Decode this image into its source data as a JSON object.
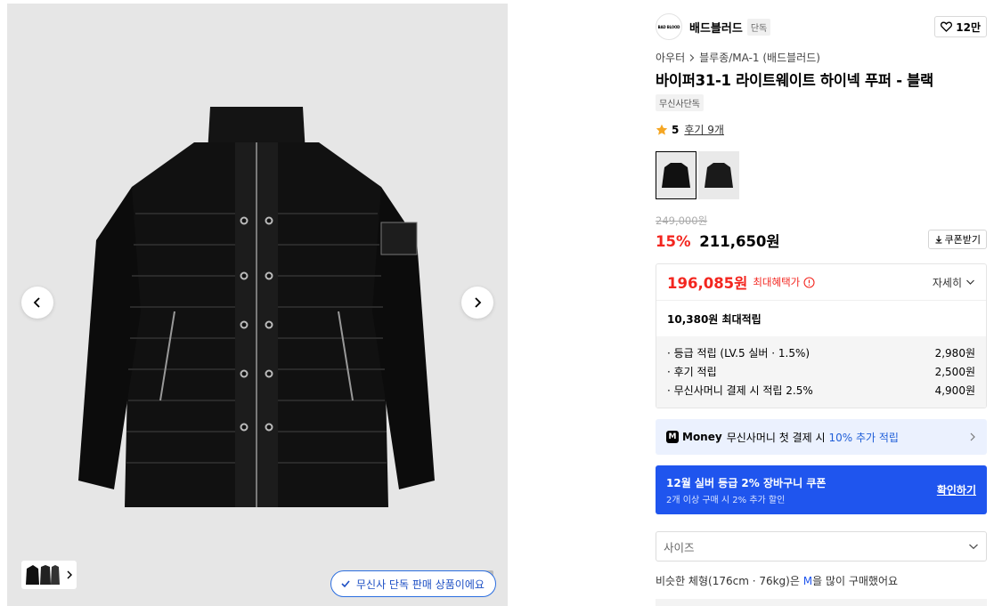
{
  "gallery": {
    "product_image": "black-lightweight-puffer-jacket",
    "prev_icon": "chevron-left-icon",
    "next_icon": "chevron-right-icon",
    "exclusive_notice": "무신사 단독 판매 상품이에요"
  },
  "brand": {
    "logo_text": "BAD BLOOD",
    "name": "배드블러드",
    "badge": "단독",
    "likes": "12만"
  },
  "breadcrumb": {
    "category": "아우터",
    "subcategory": "블루종/MA-1 (배드블러드)"
  },
  "product": {
    "title": "바이퍼31-1 라이트웨이트 하이넥 푸퍼 - 블랙",
    "tag": "무신사단독",
    "rating": "5",
    "reviews": "후기 9개"
  },
  "price": {
    "original": "249,000원",
    "discount": "15%",
    "sale": "211,650원",
    "coupon_button": "쿠폰받기"
  },
  "benefit": {
    "max_price": "196,085원",
    "max_label": "최대혜택가",
    "detail_button": "자세히",
    "points_total": "10,380원 최대적립",
    "lines": [
      {
        "label": "· 등급 적립 (LV.5 실버 · 1.5%)",
        "value": "2,980원"
      },
      {
        "label": "· 후기 적립",
        "value": "2,500원"
      },
      {
        "label": "· 무신사머니 결제 시 적립 2.5%",
        "value": "4,900원"
      }
    ]
  },
  "money_banner": {
    "logo": "M",
    "word": "Money",
    "text": "무신사머니 첫 결제 시",
    "highlight": "10% 추가 적립"
  },
  "coupon_banner": {
    "title": "12월 실버 등급 2% 장바구니 쿠폰",
    "subtitle": "2개 이상 구매 시 2% 추가 할인",
    "link": "확인하기"
  },
  "size": {
    "placeholder": "사이즈"
  },
  "fit_note": {
    "prefix": "비슷한 체형(176cm · 76kg)은",
    "size": "M",
    "suffix": "을 많이 구매했어요"
  },
  "colors": {
    "accent_red": "#f3261f",
    "accent_blue": "#1f55ee",
    "star": "#f5a623"
  }
}
